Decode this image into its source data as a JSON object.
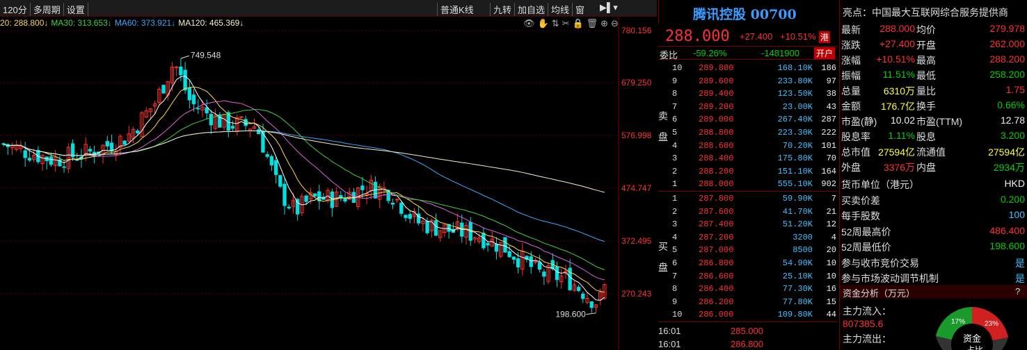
{
  "toolbar": {
    "left": [
      "120分",
      "多周期",
      "设置"
    ],
    "right": [
      "普通K线",
      "九转",
      "加自选",
      "均线",
      "窗"
    ]
  },
  "ma_legend": [
    {
      "text": "20: 288.800↓",
      "color": "#ffd84a"
    },
    {
      "text": "MA30: 313.653↓",
      "color": "#40d040"
    },
    {
      "text": "MA60: 373.921↓",
      "color": "#3ba8ff"
    },
    {
      "text": "MA120: 465.369↓",
      "color": "#f5f0c8"
    }
  ],
  "chart_tools": "👁✋⇅✂🔒🗑⊕⊖",
  "axis_labels": [
    "780.156",
    "679.250",
    "576.998",
    "474.747",
    "372.495",
    "270.243"
  ],
  "chart_marks": {
    "high": "749.548",
    "low": "198.600"
  },
  "stock": {
    "name": "腾讯控股",
    "code": "00700",
    "price": "288.000",
    "change": "+27.400",
    "pct": "+10.51%",
    "market": "港"
  },
  "weibi": {
    "label": "委比",
    "ratio": "-59.26%",
    "diff": "-1481900",
    "status": "开户"
  },
  "sell_label": "卖盘",
  "buy_label": "买盘",
  "asks": [
    {
      "n": "10",
      "p": "289.800",
      "v": "168.10K",
      "c": "186"
    },
    {
      "n": "9",
      "p": "289.600",
      "v": "233.80K",
      "c": "97"
    },
    {
      "n": "8",
      "p": "289.400",
      "v": "123.50K",
      "c": "38"
    },
    {
      "n": "7",
      "p": "289.200",
      "v": "23.00K",
      "c": "43"
    },
    {
      "n": "6",
      "p": "289.000",
      "v": "267.40K",
      "c": "287"
    },
    {
      "n": "5",
      "p": "288.800",
      "v": "223.30K",
      "c": "222"
    },
    {
      "n": "4",
      "p": "288.600",
      "v": "70.20K",
      "c": "101"
    },
    {
      "n": "3",
      "p": "288.400",
      "v": "175.80K",
      "c": "70"
    },
    {
      "n": "2",
      "p": "288.200",
      "v": "151.10K",
      "c": "164"
    },
    {
      "n": "1",
      "p": "288.000",
      "v": "555.10K",
      "c": "902"
    }
  ],
  "bids": [
    {
      "n": "1",
      "p": "287.800",
      "v": "59.90K",
      "c": "7"
    },
    {
      "n": "2",
      "p": "287.600",
      "v": "41.70K",
      "c": "21"
    },
    {
      "n": "3",
      "p": "287.400",
      "v": "51.20K",
      "c": "12"
    },
    {
      "n": "4",
      "p": "287.200",
      "v": "3200",
      "c": "4"
    },
    {
      "n": "5",
      "p": "287.000",
      "v": "8500",
      "c": "20"
    },
    {
      "n": "6",
      "p": "286.800",
      "v": "54.90K",
      "c": "10"
    },
    {
      "n": "7",
      "p": "286.600",
      "v": "25.10K",
      "c": "10"
    },
    {
      "n": "8",
      "p": "286.400",
      "v": "77.30K",
      "c": "16"
    },
    {
      "n": "9",
      "p": "286.200",
      "v": "77.80K",
      "c": "15"
    },
    {
      "n": "10",
      "p": "286.000",
      "v": "109.80K",
      "c": "44"
    }
  ],
  "trades": [
    {
      "t": "16:01",
      "p": "285.000"
    },
    {
      "t": "16:01",
      "p": "286.800"
    }
  ],
  "highlight": "亮点：中国最大互联网综合服务提供商",
  "quote": [
    {
      "a": "最新",
      "av": "288.000",
      "ac": "red",
      "b": "均价",
      "bv": "279.978",
      "bc": "red"
    },
    {
      "a": "涨跌",
      "av": "+27.400",
      "ac": "red",
      "b": "开盘",
      "bv": "262.000",
      "bc": "red"
    },
    {
      "a": "涨幅",
      "av": "+10.51%",
      "ac": "red",
      "b": "最高",
      "bv": "288.200",
      "bc": "red"
    },
    {
      "a": "振幅",
      "av": "11.51%",
      "ac": "green",
      "b": "最低",
      "bv": "258.200",
      "bc": "green"
    },
    {
      "a": "总量",
      "av": "6310万",
      "ac": "yellow",
      "b": "量比",
      "bv": "1.75",
      "bc": "red"
    },
    {
      "a": "金额",
      "av": "176.7亿",
      "ac": "yellow",
      "b": "换手",
      "bv": "0.66%",
      "bc": "green"
    },
    {
      "a": "市盈(静)",
      "av": "10.02",
      "ac": "white",
      "b": "市盈(TTM)",
      "bv": "12.78",
      "bc": "white"
    },
    {
      "a": "股息率",
      "av": "1.11%",
      "ac": "green",
      "b": "股息",
      "bv": "3.200",
      "bc": "green"
    },
    {
      "a": "总市值",
      "av": "27594亿",
      "ac": "yellow",
      "b": "流通值",
      "bv": "27594亿",
      "bc": "yellow"
    },
    {
      "a": "外盘",
      "av": "3376万",
      "ac": "red",
      "b": "内盘",
      "bv": "2934万",
      "bc": "green"
    }
  ],
  "extra": [
    {
      "k": "货币单位（港元）",
      "v": "HKD",
      "c": "white"
    },
    {
      "k": "买卖价差",
      "v": "0.200",
      "c": "green"
    },
    {
      "k": "每手股数",
      "v": "100",
      "c": "cyan"
    },
    {
      "k": "52周最高价",
      "v": "486.400",
      "c": "red"
    },
    {
      "k": "52周最低价",
      "v": "198.600",
      "c": "green"
    },
    {
      "k": "参与收市竞价交易",
      "v": "是",
      "c": "cyan"
    },
    {
      "k": "参与市场波动调节机制",
      "v": "是",
      "c": "cyan"
    }
  ],
  "fund": {
    "title": "资金分析（万元）",
    "help": "?",
    "in_label": "主力流入：",
    "in_val": "807385.6",
    "out_label": "主力流出：",
    "pie_g": "17%",
    "pie_r": "23%",
    "pie_label": "资金",
    "pie_label2": "占比"
  },
  "colors": {
    "up": "#ff3030",
    "down": "#00e0e0",
    "grid": "#5a0000",
    "accent": "#c00000"
  }
}
